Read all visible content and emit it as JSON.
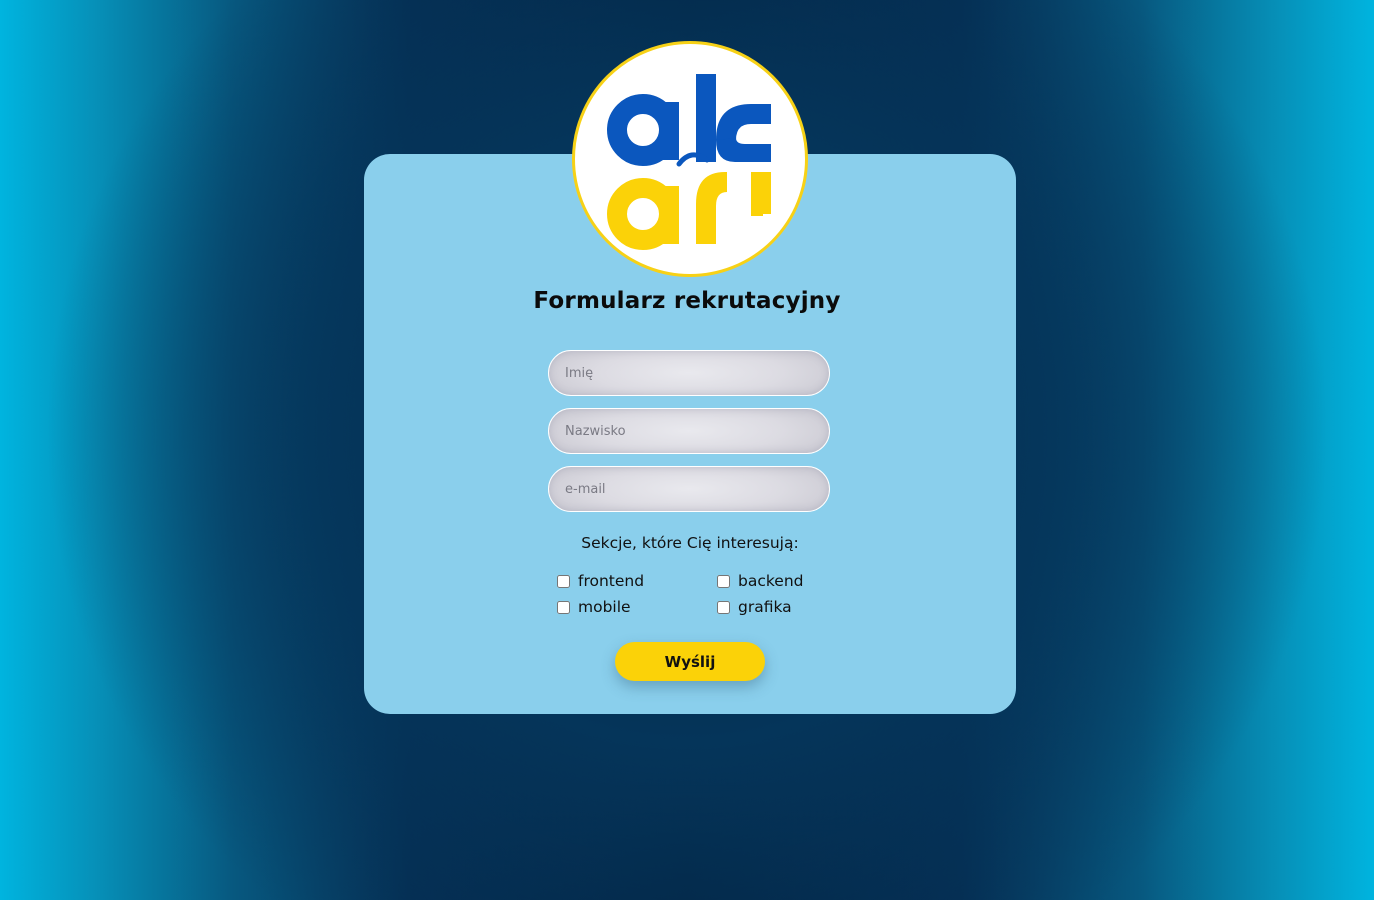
{
  "logo": {
    "icon": "ak-logo-icon",
    "colors": {
      "blue": "#0b57be",
      "yellow": "#fbd208",
      "ring": "#f7d116"
    }
  },
  "form": {
    "title": "Formularz rekrutacyjny",
    "fields": {
      "first_name": {
        "placeholder": "Imię",
        "value": ""
      },
      "last_name": {
        "placeholder": "Nazwisko",
        "value": ""
      },
      "email": {
        "placeholder": "e-mail",
        "value": ""
      }
    },
    "sections_label": "Sekcje, które Cię interesują:",
    "options": [
      {
        "label": "frontend",
        "checked": false
      },
      {
        "label": "backend",
        "checked": false
      },
      {
        "label": "mobile",
        "checked": false
      },
      {
        "label": "grafika",
        "checked": false
      }
    ],
    "submit_label": "Wyślij"
  },
  "colors": {
    "card": "#8acfec",
    "button": "#fbd208",
    "background_dark": "#03213f",
    "background_edge": "#00b4df"
  }
}
